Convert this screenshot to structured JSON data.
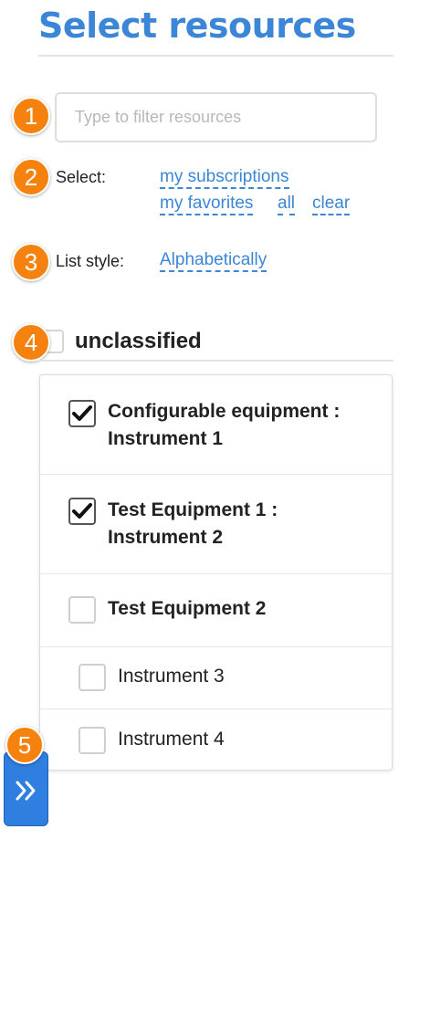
{
  "header": {
    "title": "Select resources"
  },
  "badges": [
    "1",
    "2",
    "3",
    "4",
    "5"
  ],
  "filter": {
    "placeholder": "Type to filter resources",
    "value": ""
  },
  "select": {
    "label": "Select:",
    "links": [
      "my subscriptions",
      "my favorites",
      "all",
      "clear"
    ]
  },
  "list_style": {
    "label": "List style:",
    "value": "Alphabetically"
  },
  "group": {
    "label": "unclassified",
    "checked": false
  },
  "resources": [
    {
      "line1": "Configurable equipment :",
      "line2": "Instrument 1",
      "checked": true,
      "bold": true
    },
    {
      "line1": "Test Equipment 1 :",
      "line2": "Instrument 2",
      "checked": true,
      "bold": true
    },
    {
      "line1": "Test Equipment 2",
      "line2": "",
      "checked": false,
      "bold": true
    },
    {
      "line1": "Instrument 3",
      "line2": "",
      "checked": false,
      "bold": false
    },
    {
      "line1": "Instrument 4",
      "line2": "",
      "checked": false,
      "bold": false
    }
  ],
  "expand_button": {
    "icon": "double-chevron-right-icon"
  },
  "colors": {
    "accent": "#3b86d6",
    "badge": "#f5820f",
    "button": "#2f7fe0"
  }
}
